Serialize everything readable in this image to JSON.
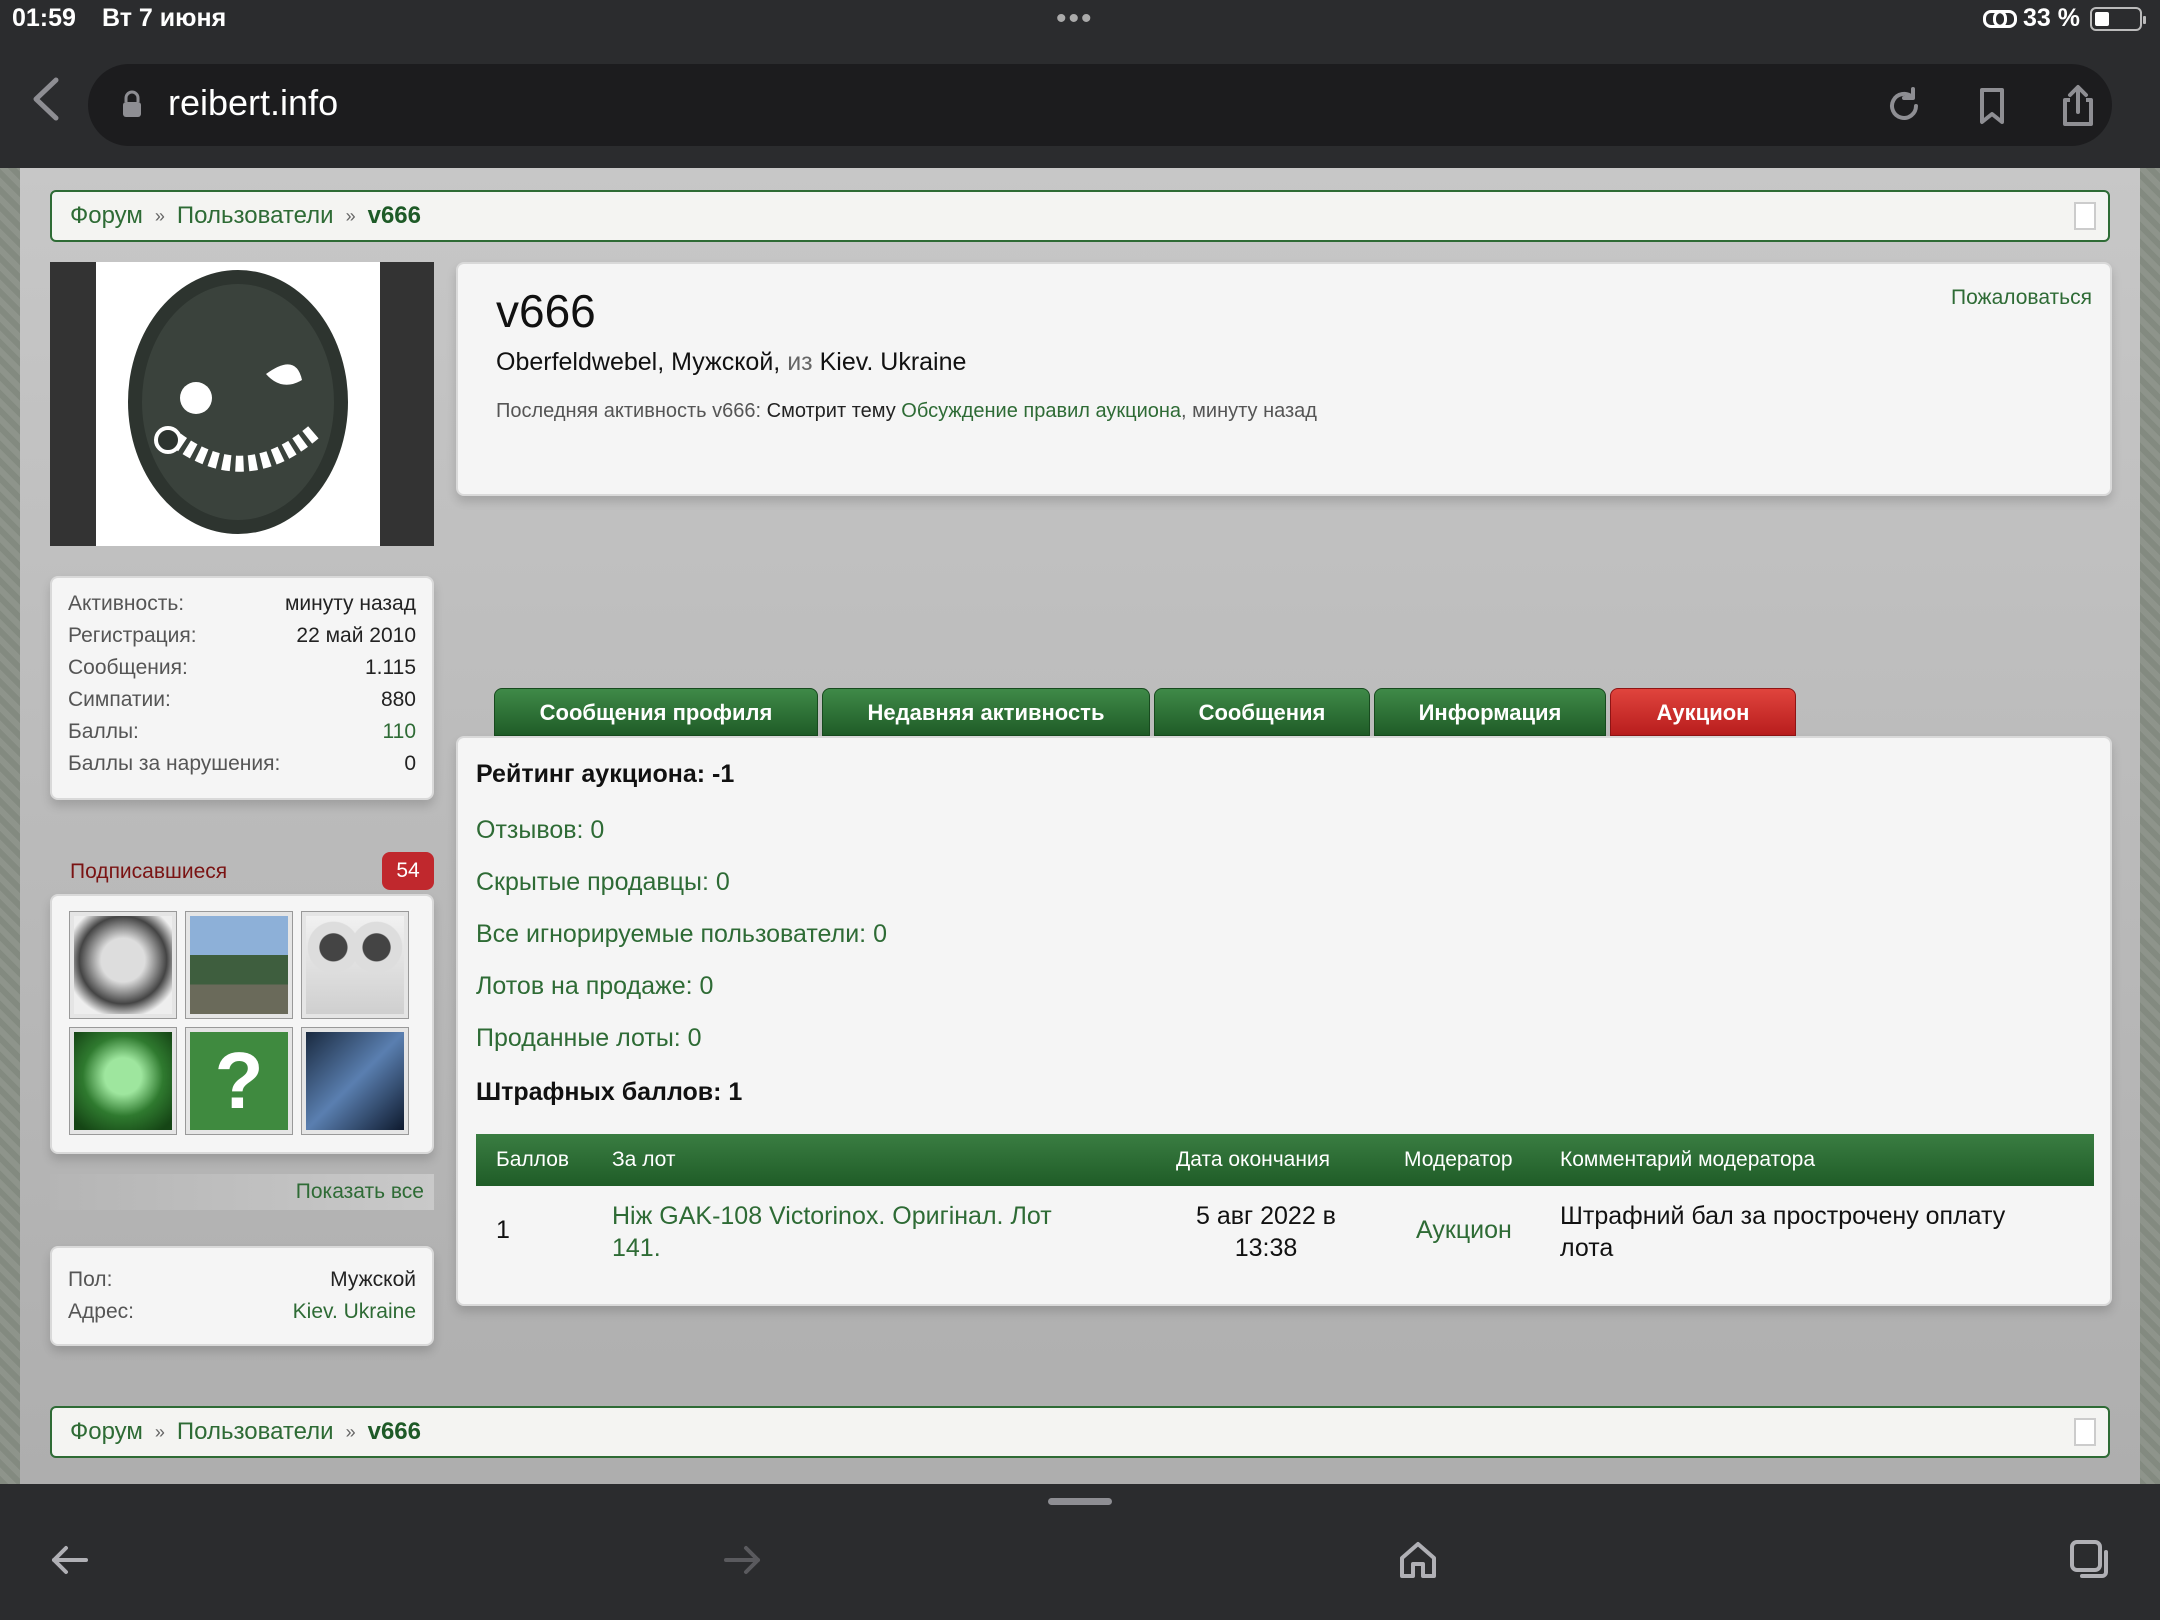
{
  "status_bar": {
    "time": "01:59",
    "date": "Вт 7 июня",
    "battery": "33 %"
  },
  "browser": {
    "url": "reibert.info"
  },
  "breadcrumb": {
    "items": [
      "Форум",
      "Пользователи",
      "v666"
    ],
    "sep": "»"
  },
  "stats": [
    {
      "k": "Активность:",
      "v": "минуту назад"
    },
    {
      "k": "Регистрация:",
      "v": "22 май 2010"
    },
    {
      "k": "Сообщения:",
      "v": "1.115"
    },
    {
      "k": "Симпатии:",
      "v": "880"
    },
    {
      "k": "Баллы:",
      "v": "110"
    },
    {
      "k": "Баллы за нарушения:",
      "v": "0"
    }
  ],
  "followers": {
    "label": "Подписавшиеся",
    "count": "54",
    "show_all": "Показать все"
  },
  "info": [
    {
      "k": "Пол:",
      "v": "Мужской"
    },
    {
      "k": "Адрес:",
      "v": "Kiev. Ukraine"
    }
  ],
  "profile": {
    "name": "v666",
    "rank": "Oberfeldwebel, Мужской,",
    "from": "из",
    "location": "Kiev. Ukraine",
    "activity_prefix": "Последняя активность v666:",
    "activity_action": "Смотрит тему",
    "activity_topic": "Обсуждение правил аукциона",
    "activity_time": ", минуту назад",
    "report": "Пожаловаться"
  },
  "tabs": [
    "Сообщения профиля",
    "Недавняя активность",
    "Сообщения",
    "Информация",
    "Аукцион"
  ],
  "auction": {
    "rating": "Рейтинг аукциона: -1",
    "links": [
      "Отзывов: 0",
      "Скрытые продавцы: 0",
      "Все игнорируемые пользователи: 0",
      "Лотов на продаже: 0",
      "Проданные лоты: 0"
    ],
    "penalty": "Штрафных баллов: 1",
    "columns": [
      "Баллов",
      "За лот",
      "Дата окончания",
      "Модератор",
      "Комментарий модератора"
    ],
    "rows": [
      {
        "points": "1",
        "lot_line1": "Ніж GAK-108 Victorinox. Оригінал. Лот",
        "lot_line2": "141.",
        "date_line1": "5 авг 2022 в",
        "date_line2": "13:38",
        "moderator": "Аукцион",
        "comment_line1": "Штрафний бал за прострочену оплату",
        "comment_line2": "лота"
      }
    ]
  },
  "colors": {
    "accent_green": "#2e6b35",
    "active_tab_red": "#c0282d"
  }
}
